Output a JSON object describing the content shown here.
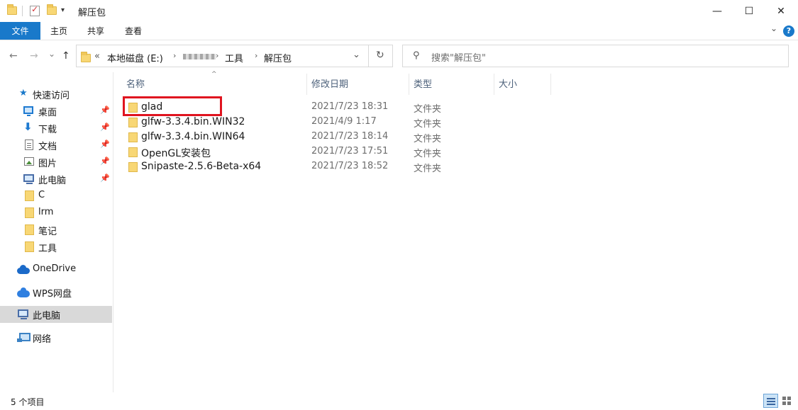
{
  "window": {
    "title": "解压包",
    "minimize": "—",
    "maximize": "☐",
    "close": "✕",
    "qa_dropdown": "▾"
  },
  "ribbon": {
    "tabs": [
      "文件",
      "主页",
      "共享",
      "查看"
    ],
    "expand_icon": "⌄",
    "help": "?"
  },
  "nav": {
    "back": "←",
    "forward": "→",
    "recent": "⌄",
    "up": "↑",
    "breadcrumb_overflow": "«",
    "crumbs": [
      "本地磁盘 (E:)",
      "工具",
      "解压包"
    ],
    "crumb_arrow": "›",
    "dropdown": "⌄",
    "refresh": "↻"
  },
  "search": {
    "placeholder": "搜索\"解压包\"",
    "icon": "⚲"
  },
  "sidebar": {
    "items": [
      {
        "label": "快速访问",
        "icon": "star-icon"
      },
      {
        "label": "桌面",
        "icon": "desktop-icon",
        "pinned": true
      },
      {
        "label": "下载",
        "icon": "download-icon",
        "pinned": true
      },
      {
        "label": "文档",
        "icon": "document-icon",
        "pinned": true
      },
      {
        "label": "图片",
        "icon": "pictures-icon",
        "pinned": true
      },
      {
        "label": "此电脑",
        "icon": "computer-icon",
        "pinned": true
      },
      {
        "label": "C",
        "icon": "folder-icon"
      },
      {
        "label": "lrm",
        "icon": "folder-icon"
      },
      {
        "label": "笔记",
        "icon": "folder-icon"
      },
      {
        "label": "工具",
        "icon": "folder-icon"
      },
      {
        "label": "OneDrive",
        "icon": "onedrive-icon"
      },
      {
        "label": "WPS网盘",
        "icon": "wps-cloud-icon"
      },
      {
        "label": "此电脑",
        "icon": "computer-icon",
        "selected": true
      },
      {
        "label": "网络",
        "icon": "network-icon"
      }
    ],
    "pin_glyph": "📌",
    "star_glyph": "★",
    "down_glyph": "⬇"
  },
  "columns": {
    "name": "名称",
    "date": "修改日期",
    "type": "类型",
    "size": "大小",
    "sort_glyph": "^"
  },
  "files": [
    {
      "name": "glad",
      "date": "2021/7/23 18:31",
      "type": "文件夹",
      "highlighted": true
    },
    {
      "name": "glfw-3.3.4.bin.WIN32",
      "date": "2021/4/9 1:17",
      "type": "文件夹"
    },
    {
      "name": "glfw-3.3.4.bin.WIN64",
      "date": "2021/7/23 18:14",
      "type": "文件夹"
    },
    {
      "name": "OpenGL安装包",
      "date": "2021/7/23 17:51",
      "type": "文件夹"
    },
    {
      "name": "Snipaste-2.5.6-Beta-x64",
      "date": "2021/7/23 18:52",
      "type": "文件夹"
    }
  ],
  "status": {
    "count": "5 个项目"
  },
  "colors": {
    "accent": "#1979ca",
    "highlight_box": "#e0141f",
    "folder": "#f8d775"
  }
}
